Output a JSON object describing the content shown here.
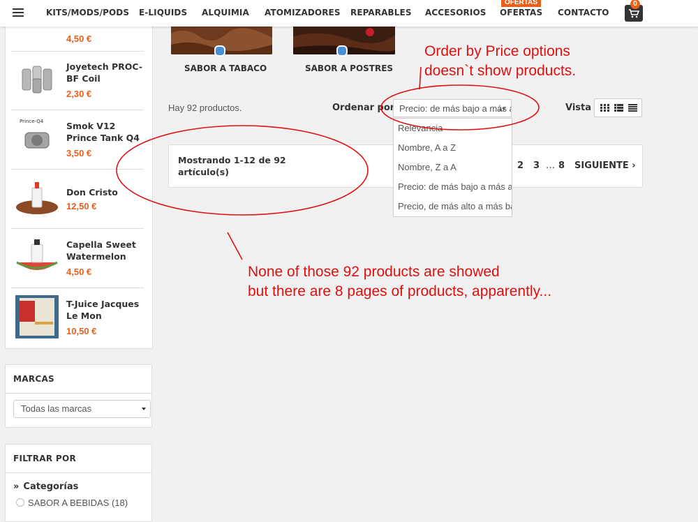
{
  "nav": {
    "items": [
      "KITS/MODS/PODS",
      "E-LIQUIDS",
      "ALQUIMIA",
      "ATOMIZADORES",
      "REPARABLES",
      "ACCESORIOS",
      "OFERTAS",
      "CONTACTO"
    ],
    "ofertas_badge": "OFERTAS",
    "cart_count": "0"
  },
  "sidebar": {
    "products": [
      {
        "name": "",
        "price": "4,50 €"
      },
      {
        "name": "Joyetech PROC-BF Coil",
        "price": "2,30 €"
      },
      {
        "name": "Smok V12 Prince Tank Q4",
        "price": "3,50 €",
        "thumb_text": "Prince-Q4"
      },
      {
        "name": "Don Cristo",
        "price": "12,50 €"
      },
      {
        "name": "Capella Sweet Watermelon",
        "price": "4,50 €"
      },
      {
        "name": "T-Juice Jacques Le Mon",
        "price": "10,50 €"
      }
    ],
    "marcas_title": "MARCAS",
    "marcas_select": "Todas las marcas",
    "filtrar_title": "FILTRAR POR",
    "categorias_label": "Categorías",
    "category_option": "SABOR A BEBIDAS (18)"
  },
  "categories": [
    {
      "label": "SABOR A TABACO"
    },
    {
      "label": "SABOR A POSTRES"
    }
  ],
  "toolbar": {
    "count_text": "Hay 92 productos.",
    "sort_label": "Ordenar por:",
    "sort_selected": "Precio: de más bajo a más alto",
    "sort_options": [
      "Relevancia",
      "Nombre, A a Z",
      "Nombre, Z a A",
      "Precio: de más bajo a más alto",
      "Precio, de más alto a más bajo"
    ],
    "vista_label": "Vista"
  },
  "pagination": {
    "showing": "Mostrando 1-12 de 92 artículo(s)",
    "pages": [
      "2",
      "3",
      "…",
      "8"
    ],
    "next_label": "SIGUIENTE ›"
  },
  "annotations": {
    "top_note": [
      "Order by Price options",
      "doesn`t show products."
    ],
    "bottom_note": [
      "None of those 92 products are showed",
      "but there are 8 pages of products, apparently..."
    ]
  },
  "colors": {
    "accent": "#e8601c",
    "annotation": "#e01010"
  }
}
